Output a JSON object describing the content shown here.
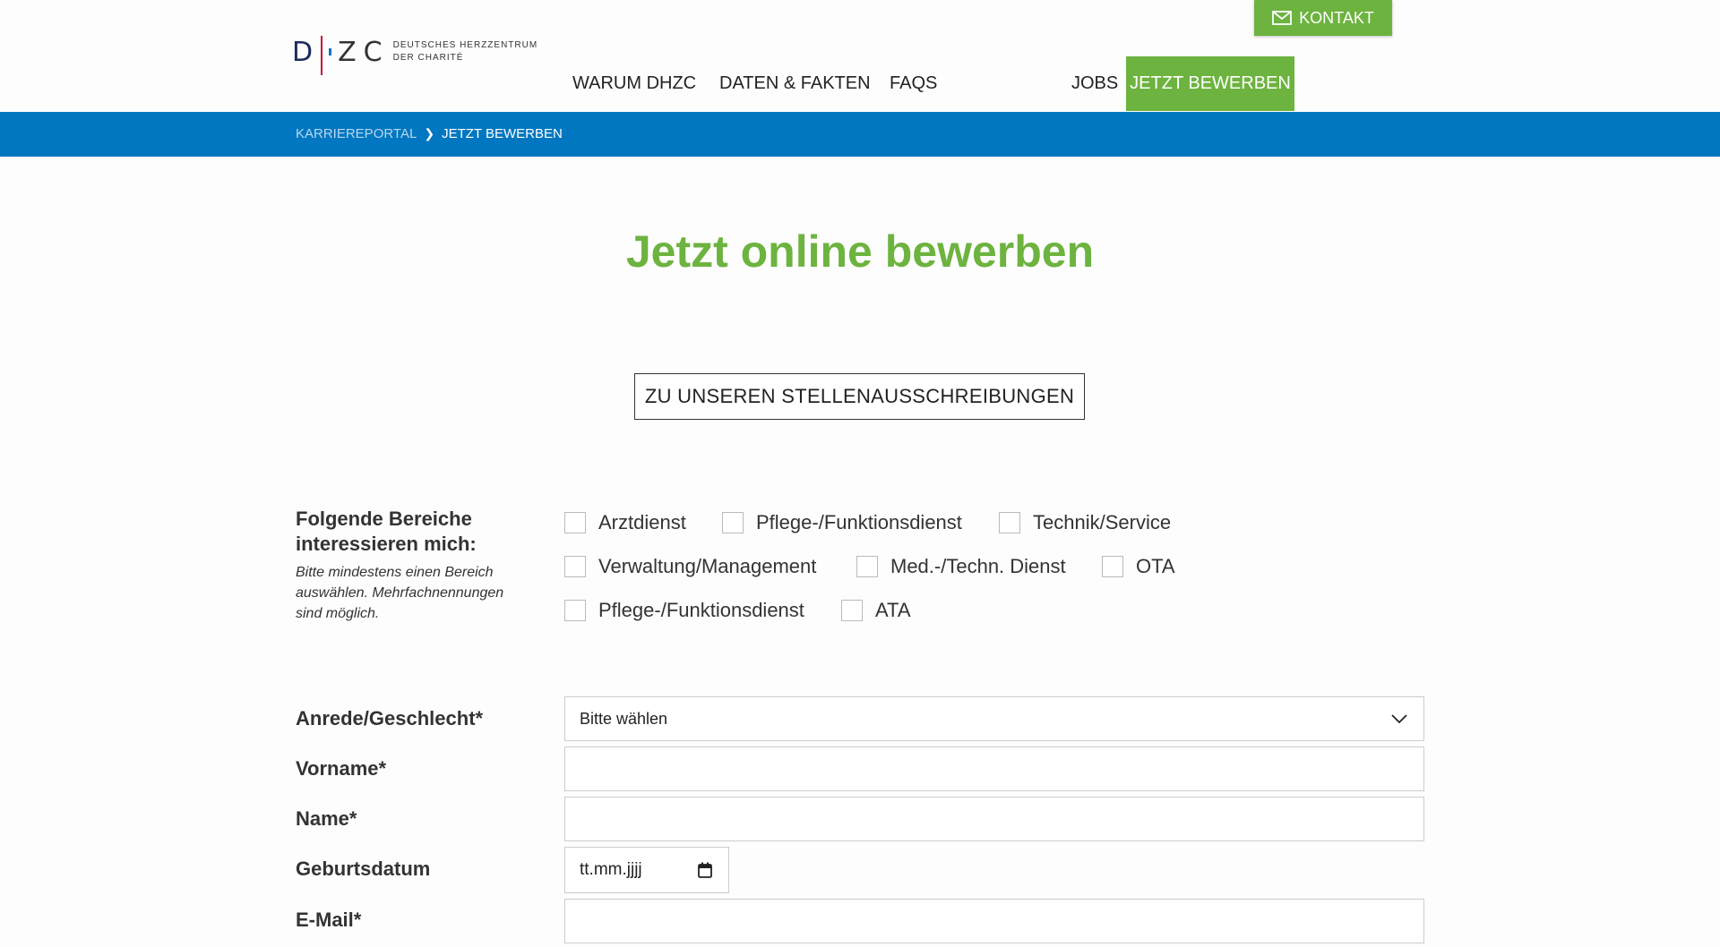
{
  "header": {
    "logo": {
      "mark": "DHZC",
      "line1": "DEUTSCHES HERZZENTRUM",
      "line2": "DER CHARITÉ"
    },
    "kontakt_label": "KONTAKT",
    "nav": {
      "warum": "WARUM DHZC",
      "daten": "DATEN & FAKTEN",
      "faqs": "FAQS",
      "jobs": "JOBS",
      "cta": "JETZT BEWERBEN"
    }
  },
  "breadcrumb": {
    "parent": "KARRIEREPORTAL",
    "current": "JETZT BEWERBEN"
  },
  "main": {
    "title": "Jetzt online bewerben",
    "jobs_button": "ZU UNSEREN STELLENAUSSCHREIBUNGEN",
    "interest": {
      "label": "Folgende Bereiche interessieren mich:",
      "hint": "Bitte mindestens einen Bereich auswählen. Mehrfachnennungen sind möglich.",
      "options": [
        "Arztdienst",
        "Pflege-/Funktionsdienst",
        "Technik/Service",
        "Verwaltung/Management",
        "Med.-/Techn. Dienst",
        "OTA",
        "Pflege-/Funktionsdienst",
        "ATA"
      ]
    },
    "form": {
      "anrede_label": "Anrede/Geschlecht*",
      "anrede_value": "Bitte wählen",
      "vorname_label": "Vorname*",
      "name_label": "Name*",
      "geburtsdatum_label": "Geburtsdatum",
      "geburtsdatum_placeholder": "tt.mm.jjjj",
      "email_label": "E-Mail*"
    }
  }
}
